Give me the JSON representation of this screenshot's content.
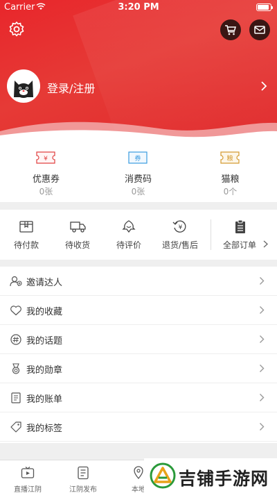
{
  "status_bar": {
    "carrier": "Carrier",
    "time": "3:20 PM"
  },
  "header": {
    "login_text": "登录/注册"
  },
  "stats": [
    {
      "label": "优惠券",
      "value": "0张",
      "icon_text": "¥",
      "icon": "coupon-icon"
    },
    {
      "label": "消费码",
      "value": "0张",
      "icon_text": "券",
      "icon": "consumption-code-icon"
    },
    {
      "label": "猫粮",
      "value": "0个",
      "icon_text": "粮",
      "icon": "cat-food-icon"
    }
  ],
  "orders": [
    {
      "label": "待付款",
      "icon": "wallet-icon"
    },
    {
      "label": "待收货",
      "icon": "truck-icon"
    },
    {
      "label": "待评价",
      "icon": "review-icon"
    },
    {
      "label": "退货/售后",
      "icon": "refund-icon",
      "icon_text": "¥"
    }
  ],
  "orders_all": {
    "label": "全部订单",
    "icon": "clipboard-icon"
  },
  "menu": [
    {
      "label": "邀请达人",
      "icon": "invite-icon"
    },
    {
      "label": "我的收藏",
      "icon": "heart-icon"
    },
    {
      "label": "我的话题",
      "icon": "hashtag-icon"
    },
    {
      "label": "我的勋章",
      "icon": "medal-icon"
    },
    {
      "label": "我的账单",
      "icon": "bill-icon"
    },
    {
      "label": "我的标签",
      "icon": "tag-icon"
    }
  ],
  "tabbar": [
    {
      "label": "直播江阴",
      "icon": "tv-icon"
    },
    {
      "label": "江阴发布",
      "icon": "news-icon"
    },
    {
      "label": "本地",
      "icon": "local-icon"
    }
  ],
  "watermark": {
    "text": "吉铺手游网"
  },
  "colors": {
    "brand_red": "#e8262b",
    "coupon": "#e04040",
    "code": "#3a9be0",
    "catfood": "#d49a30"
  }
}
